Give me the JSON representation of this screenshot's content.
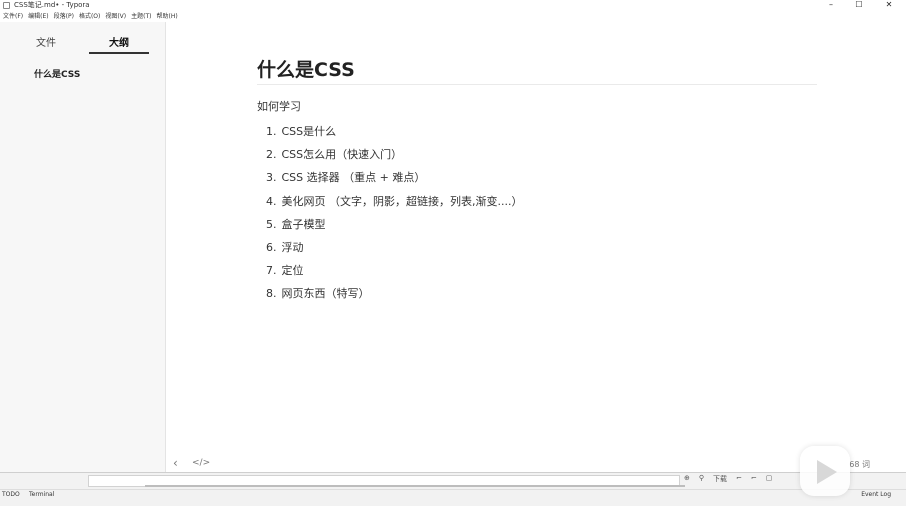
{
  "window": {
    "title": "CSS笔记.md• - Typora",
    "minimize": "–",
    "maximize": "☐",
    "close": "✕"
  },
  "menubar": [
    "文件(F)",
    "编辑(E)",
    "段落(P)",
    "格式(O)",
    "视图(V)",
    "主题(T)",
    "帮助(H)"
  ],
  "sidebar": {
    "tabs": [
      "文件",
      "大纲"
    ],
    "active_tab": "大纲",
    "outline": [
      "什么是CSS"
    ]
  },
  "document": {
    "heading": "什么是CSS",
    "paragraph": "如何学习",
    "list": [
      {
        "num": "1.",
        "text": "CSS是什么"
      },
      {
        "num": "2.",
        "text": "CSS怎么用（快速入门）"
      },
      {
        "num": "3.",
        "text": "CSS 选择器 （重点 + 难点）"
      },
      {
        "num": "4.",
        "text": "美化网页 （文字，阴影，超链接，列表,渐变....）"
      },
      {
        "num": "5.",
        "text": "盒子模型"
      },
      {
        "num": "6.",
        "text": "浮动"
      },
      {
        "num": "7.",
        "text": "定位"
      },
      {
        "num": "8.",
        "text": "网页东西（特写）"
      }
    ]
  },
  "editor_footer": {
    "back_icon": "‹",
    "source_icon": "</>",
    "word_count": "68 词"
  },
  "ide_strip": {
    "icons": [
      "⊕",
      "⚲",
      "下载",
      "⌐",
      "⌐",
      "▢"
    ],
    "todo": "TODO",
    "terminal": "Terminal",
    "status_right": "Event Log"
  },
  "watermark": {
    "play_icon": "play-icon"
  },
  "colors": {
    "sidebar_bg": "#f7f7f7",
    "active_underline": "#333333"
  }
}
